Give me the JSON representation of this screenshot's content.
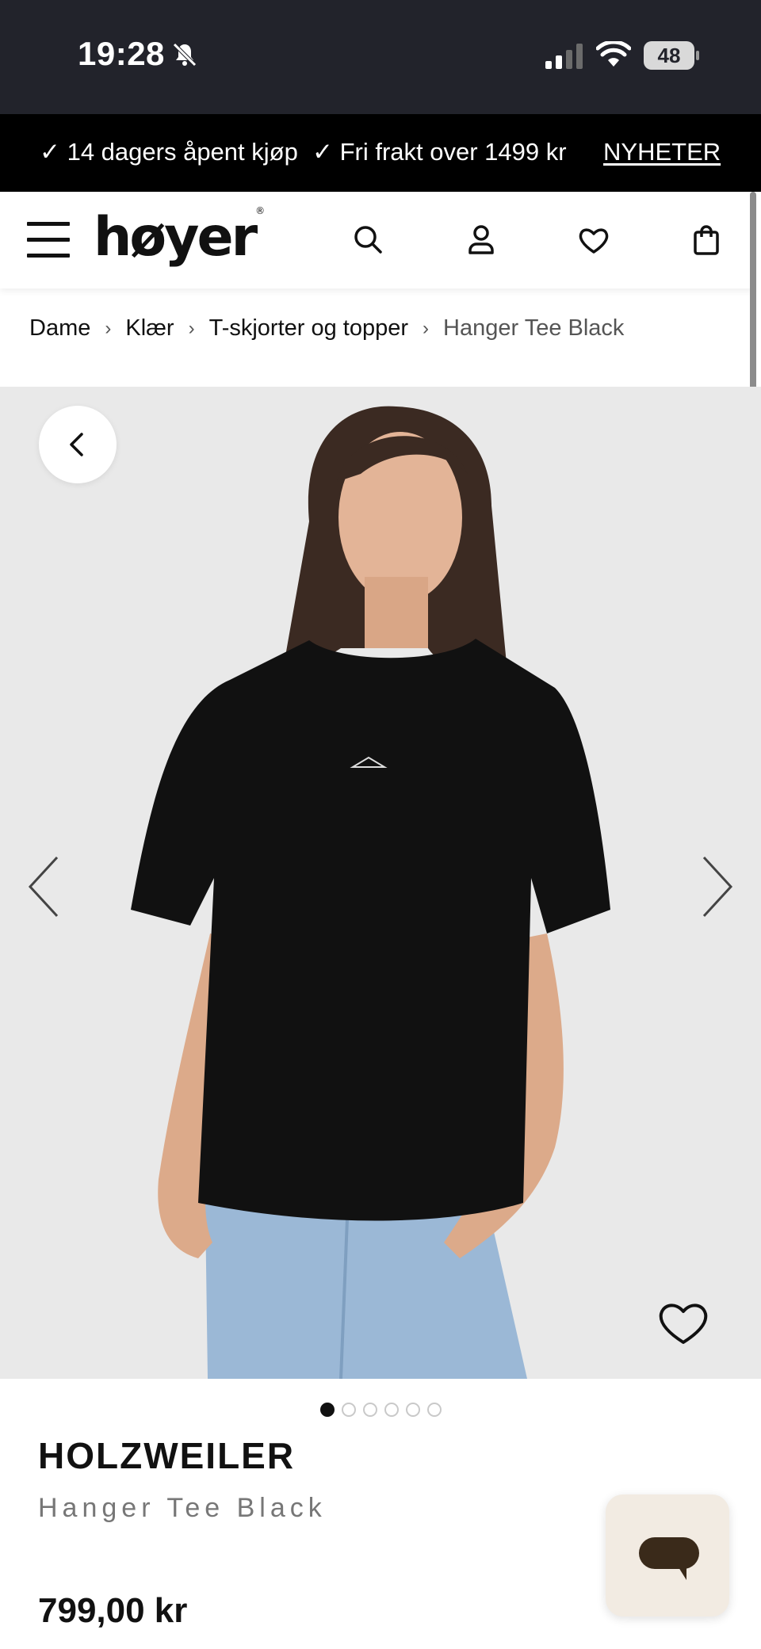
{
  "status_bar": {
    "time": "19:28",
    "battery": "48",
    "icons": [
      "bell-slash-icon",
      "signal-icon",
      "wifi-icon",
      "battery-icon"
    ]
  },
  "promo": {
    "item1": "✓ 14 dagers åpent kjøp",
    "item2": "✓ Fri frakt over 1499 kr",
    "link": "NYHETER"
  },
  "header": {
    "logo": "høyer",
    "logo_mark": "®",
    "icons": [
      "menu-icon",
      "search-icon",
      "account-icon",
      "heart-icon",
      "bag-icon"
    ]
  },
  "breadcrumb": {
    "items": [
      "Dame",
      "Klær",
      "T-skjorter og topper"
    ],
    "current": "Hanger Tee Black",
    "separator": "›"
  },
  "gallery": {
    "image_count": 6,
    "active_index": 0
  },
  "product": {
    "brand": "HOLZWEILER",
    "name": "Hanger Tee Black",
    "price": "799,00 kr"
  },
  "colors": {
    "status_bar_bg": "#22232b",
    "promo_bg": "#000000",
    "gallery_bg": "#e9e9e9",
    "chat_bg": "#f2ebe2"
  }
}
